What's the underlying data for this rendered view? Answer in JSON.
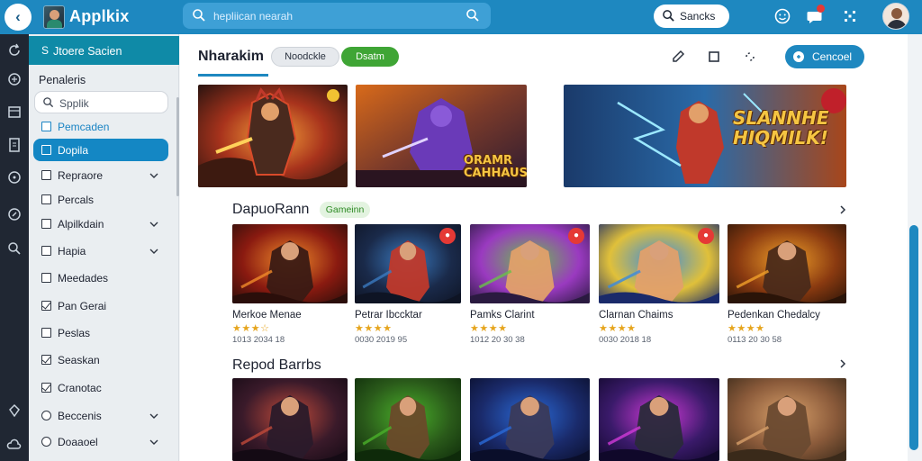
{
  "header": {
    "app_title": "Applkix",
    "search_placeholder": "hepliican nearah",
    "search_pill_label": "Sancks"
  },
  "sidebar": {
    "header_label": "Jtoere Sacien",
    "section_title": "Penaleris",
    "search_placeholder": "Spplik",
    "items": [
      {
        "label": "Pemcaden",
        "state": "highlight",
        "control": "checkbox",
        "checked": false,
        "chevron": false
      },
      {
        "label": "Dopila",
        "state": "active",
        "control": "checkbox",
        "checked": false,
        "chevron": false
      },
      {
        "label": "Repraore",
        "state": "normal",
        "control": "checkbox",
        "checked": false,
        "chevron": true
      },
      {
        "label": "Percals",
        "state": "normal",
        "control": "checkbox",
        "checked": false,
        "chevron": false
      },
      {
        "label": "Alpilkdain",
        "state": "normal",
        "control": "checkbox",
        "checked": false,
        "chevron": true
      },
      {
        "label": "Hapia",
        "state": "normal",
        "control": "checkbox",
        "checked": false,
        "chevron": true
      },
      {
        "label": "Meedades",
        "state": "normal",
        "control": "checkbox",
        "checked": false,
        "chevron": false
      },
      {
        "label": "Pan Gerai",
        "state": "normal",
        "control": "checkbox",
        "checked": true,
        "chevron": false
      },
      {
        "label": "Peslas",
        "state": "normal",
        "control": "checkbox",
        "checked": false,
        "chevron": false
      },
      {
        "label": "Seaskan",
        "state": "normal",
        "control": "checkbox",
        "checked": true,
        "chevron": false
      },
      {
        "label": "Cranotac",
        "state": "normal",
        "control": "checkbox",
        "checked": true,
        "chevron": false
      },
      {
        "label": "Beccenis",
        "state": "normal",
        "control": "radio",
        "checked": false,
        "chevron": true
      },
      {
        "label": "Doaaoel",
        "state": "normal",
        "control": "radio",
        "checked": false,
        "chevron": true
      }
    ]
  },
  "main": {
    "page_title": "Nharakim",
    "chip_gray": "Noodckle",
    "chip_green": "Dsatm",
    "cancel_label": "Cencoel",
    "banners": [
      {
        "overlay_text": "",
        "theme": "warrior-red"
      },
      {
        "overlay_text": "ORAMR CAHHAUS",
        "theme": "purple-mage"
      },
      {
        "overlay_text": "SLANNHE HIQMILK!",
        "theme": "lightning-hero"
      }
    ],
    "section1": {
      "title": "DapuoRann",
      "tag": "Gameinn",
      "cards": [
        {
          "name": "Merkoe Menae",
          "stars": "★★★☆",
          "meta": "1013 2034 18",
          "theme": "fire-knight",
          "badge": ""
        },
        {
          "name": "Petrar Ibccktar",
          "stars": "★★★★",
          "meta": "0030 2019 95",
          "theme": "blue-warrior",
          "badge": "●"
        },
        {
          "name": "Pamks Clarint",
          "stars": "★★★★",
          "meta": "1012 20 30 38",
          "theme": "cartoon-duo",
          "badge": "●"
        },
        {
          "name": "Clarnan Chaims",
          "stars": "★★★★",
          "meta": "0030 2018 18",
          "theme": "brawl-heroes",
          "badge": "●"
        },
        {
          "name": "Pedenkan Chedalcy",
          "stars": "★★★★",
          "meta": "0113 20 30 58",
          "theme": "soldier-orange",
          "badge": ""
        }
      ]
    },
    "section2": {
      "title": "Repod Barrbs",
      "cards": [
        {
          "theme": "dark-assassin"
        },
        {
          "theme": "green-hulk"
        },
        {
          "theme": "blue-robot"
        },
        {
          "theme": "neon-knight"
        },
        {
          "theme": "desert-creature"
        }
      ]
    }
  },
  "colors": {
    "brand": "#1e88c0",
    "active_item": "#1487c4",
    "sidebar_header": "#0f8aa7",
    "chip_green": "#3fa535",
    "rail": "#202733"
  }
}
